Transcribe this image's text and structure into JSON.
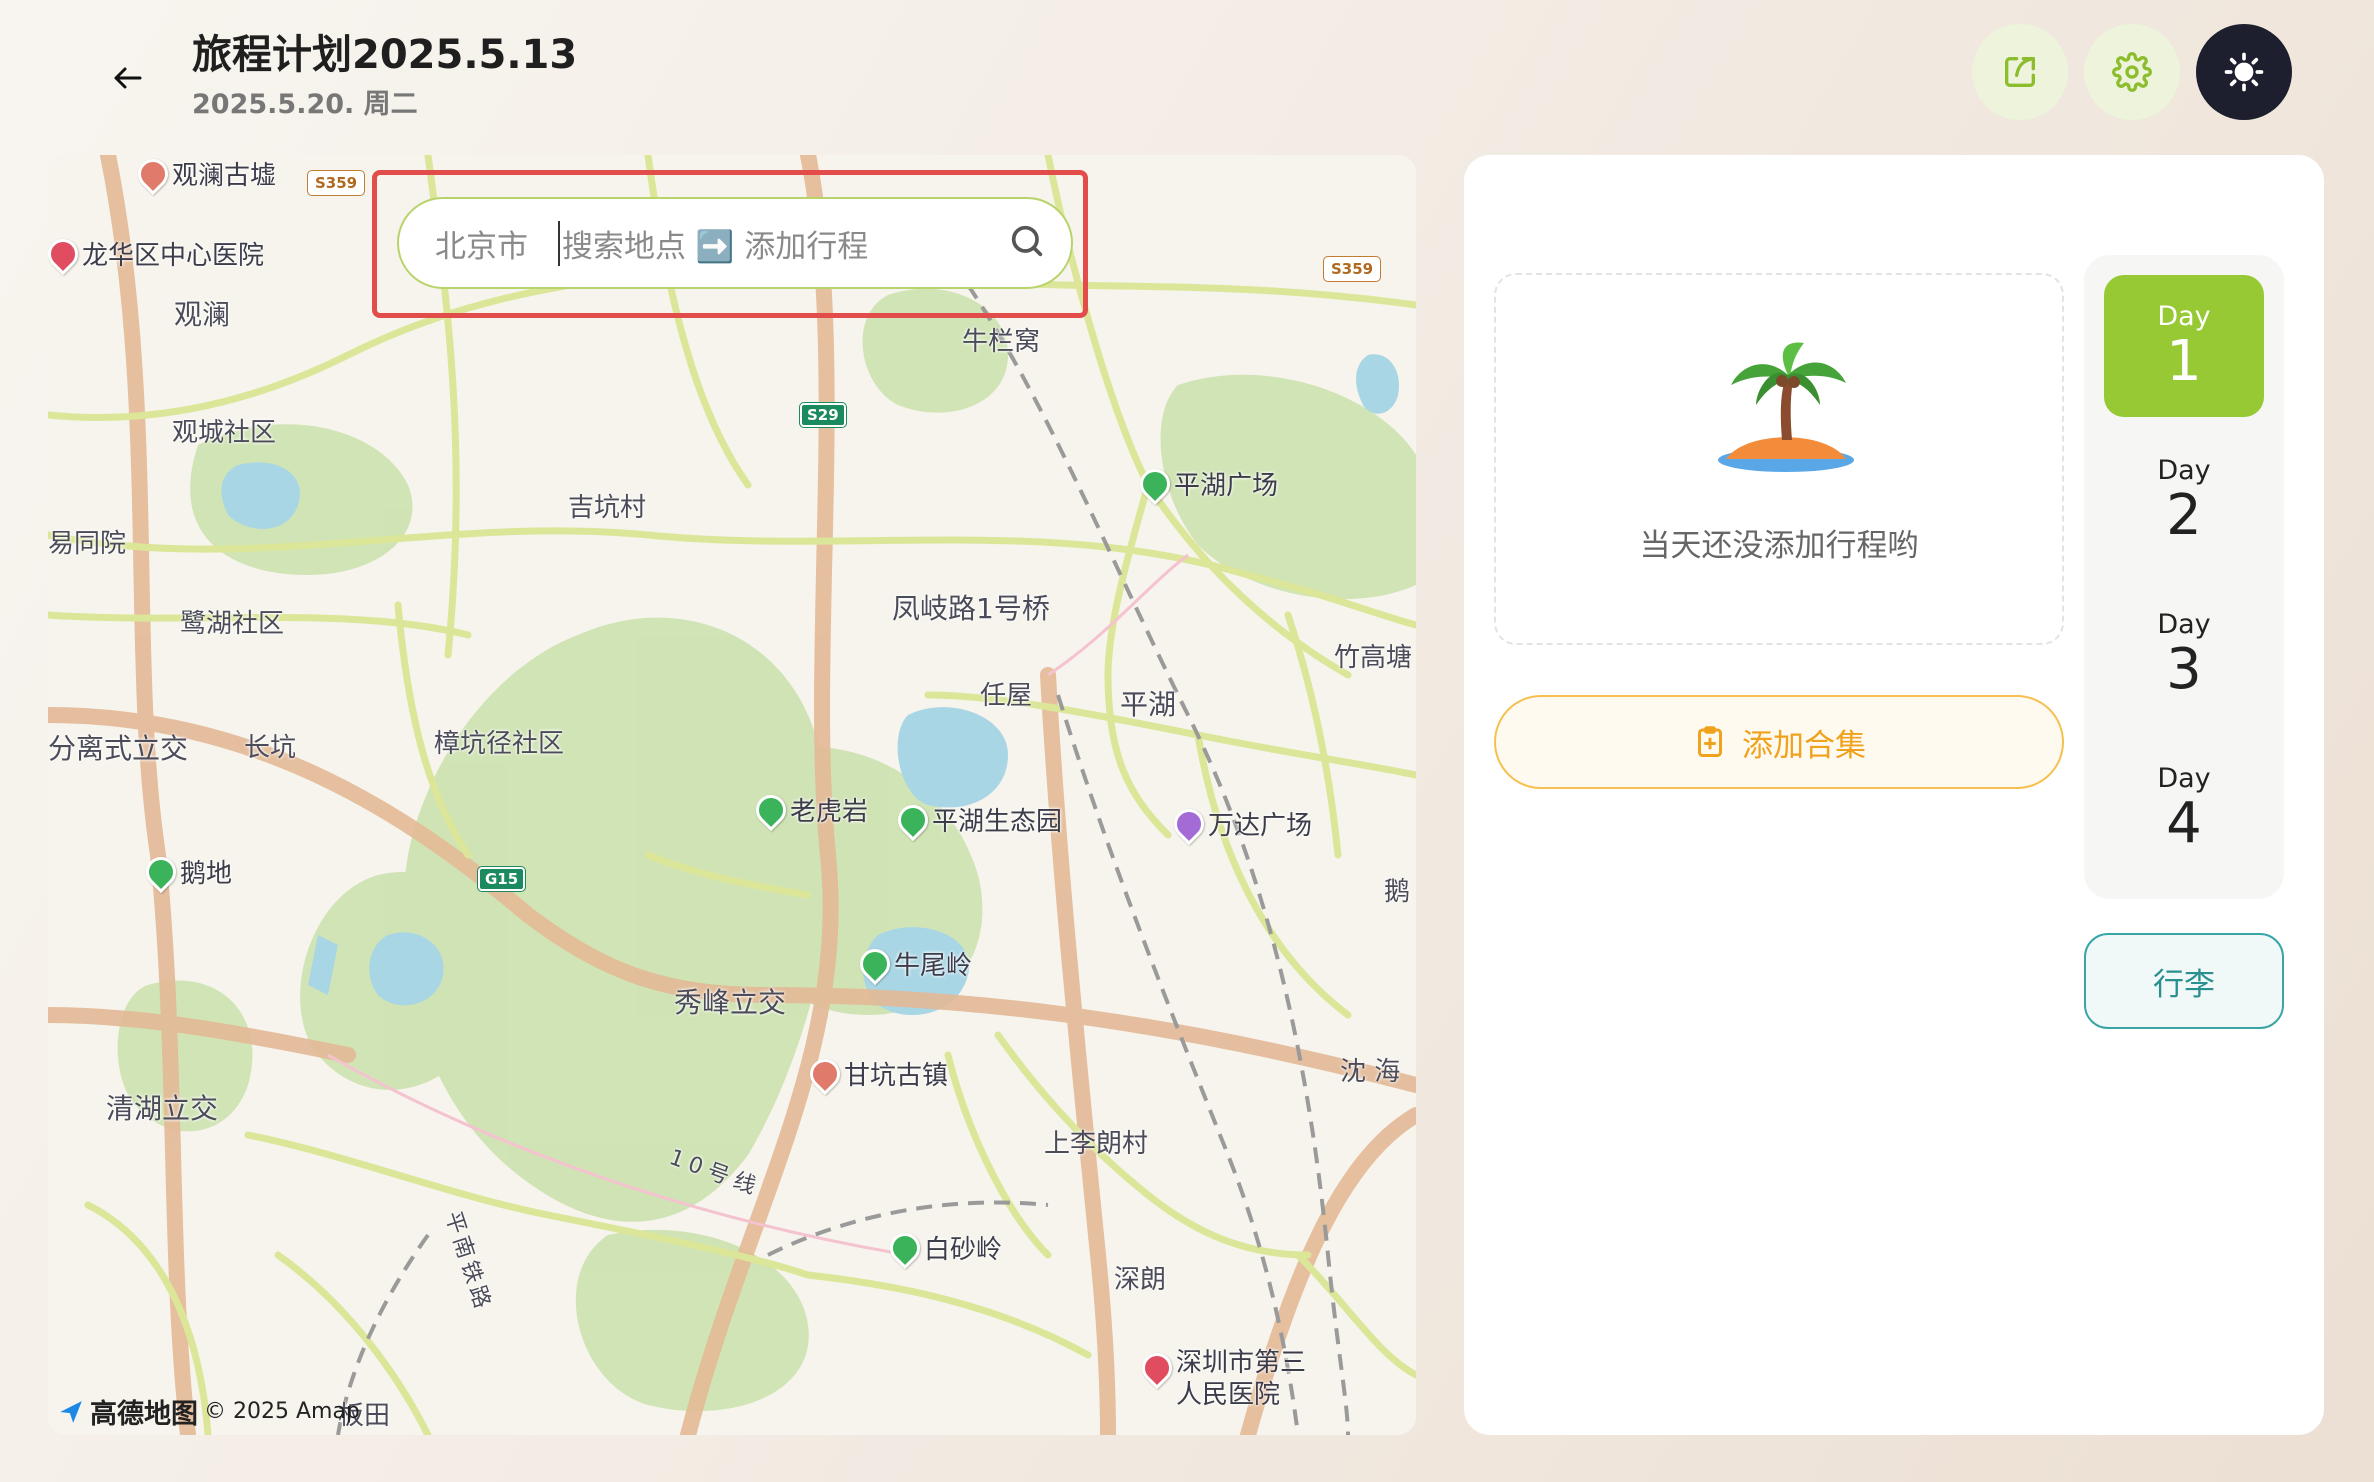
{
  "header": {
    "title": "旅程计划2025.5.13",
    "subtitle": "2025.5.20. 周二"
  },
  "map": {
    "search": {
      "city": "北京市",
      "placeholder": "搜索地点 ➡️ 添加行程"
    },
    "places": [
      "观澜古墟",
      "龙华区中心医院",
      "观澜",
      "观城社区",
      "易同院",
      "鹭湖社区",
      "吉坑村",
      "牛栏窝",
      "平湖广场",
      "凤岐路1号桥",
      "任屋",
      "平湖",
      "竹高塘",
      "分离式立交",
      "长坑",
      "樟坑径社区",
      "老虎岩",
      "平湖生态园",
      "万达广场",
      "鹅地",
      "牛尾岭",
      "秀峰立交",
      "甘坑古镇",
      "沈 海",
      "清湖立交",
      "上李朗村",
      "10号线",
      "白砂岭",
      "深朗",
      "深圳市第三人民医院",
      "平南铁路",
      "板田",
      "鹅"
    ],
    "shields": [
      "S359",
      "S359",
      "S29",
      "G15"
    ],
    "attribution": {
      "logo": "高德地图",
      "copyright": "© 2025 Amap"
    }
  },
  "panel": {
    "empty_text": "当天还没添加行程哟",
    "add_collection_label": "添加合集",
    "days": [
      {
        "label": "Day",
        "num": "1"
      },
      {
        "label": "Day",
        "num": "2"
      },
      {
        "label": "Day",
        "num": "3"
      },
      {
        "label": "Day",
        "num": "4"
      }
    ],
    "luggage_label": "行李"
  },
  "colors": {
    "accent_green": "#96c934",
    "accent_orange": "#f0a21c",
    "teal": "#2a8f8f",
    "highlight_red": "#e24c4b"
  }
}
